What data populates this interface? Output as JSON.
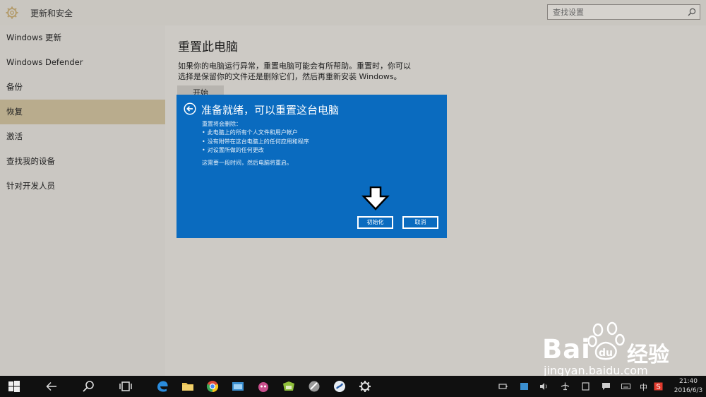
{
  "window": {
    "title": "更新和安全",
    "search_placeholder": "查找设置"
  },
  "sidebar": {
    "items": [
      {
        "label": "Windows 更新"
      },
      {
        "label": "Windows Defender"
      },
      {
        "label": "备份"
      },
      {
        "label": "恢复",
        "active": true
      },
      {
        "label": "激活"
      },
      {
        "label": "查找我的设备"
      },
      {
        "label": "针对开发人员"
      }
    ]
  },
  "main": {
    "heading": "重置此电脑",
    "description": "如果你的电脑运行异常，重置电脑可能会有所帮助。重置时，你可以选择是保留你的文件还是删除它们，然后再重新安装 Windows。",
    "start_button": "开始"
  },
  "dialog": {
    "title": "准备就绪，可以重置这台电脑",
    "subtitle": "重置将会删除：",
    "bullets": [
      "此电脑上的所有个人文件和用户帐户",
      "没有附带在这台电脑上的任何应用和程序",
      "对设置所做的任何更改"
    ],
    "note": "这需要一段时间，然后电脑将重启。",
    "init_button": "初始化",
    "cancel_button": "取消"
  },
  "watermark": {
    "brand": "Bai",
    "brand_cn": "经验",
    "url": "jingyan.baidu.com"
  },
  "taskbar": {
    "ime": "中",
    "time": "21:40",
    "date": "2016/6/3"
  },
  "colors": {
    "dialog_bg": "#0a6bbf",
    "active_nav": "#b9ac8d",
    "taskbar": "#101010"
  }
}
